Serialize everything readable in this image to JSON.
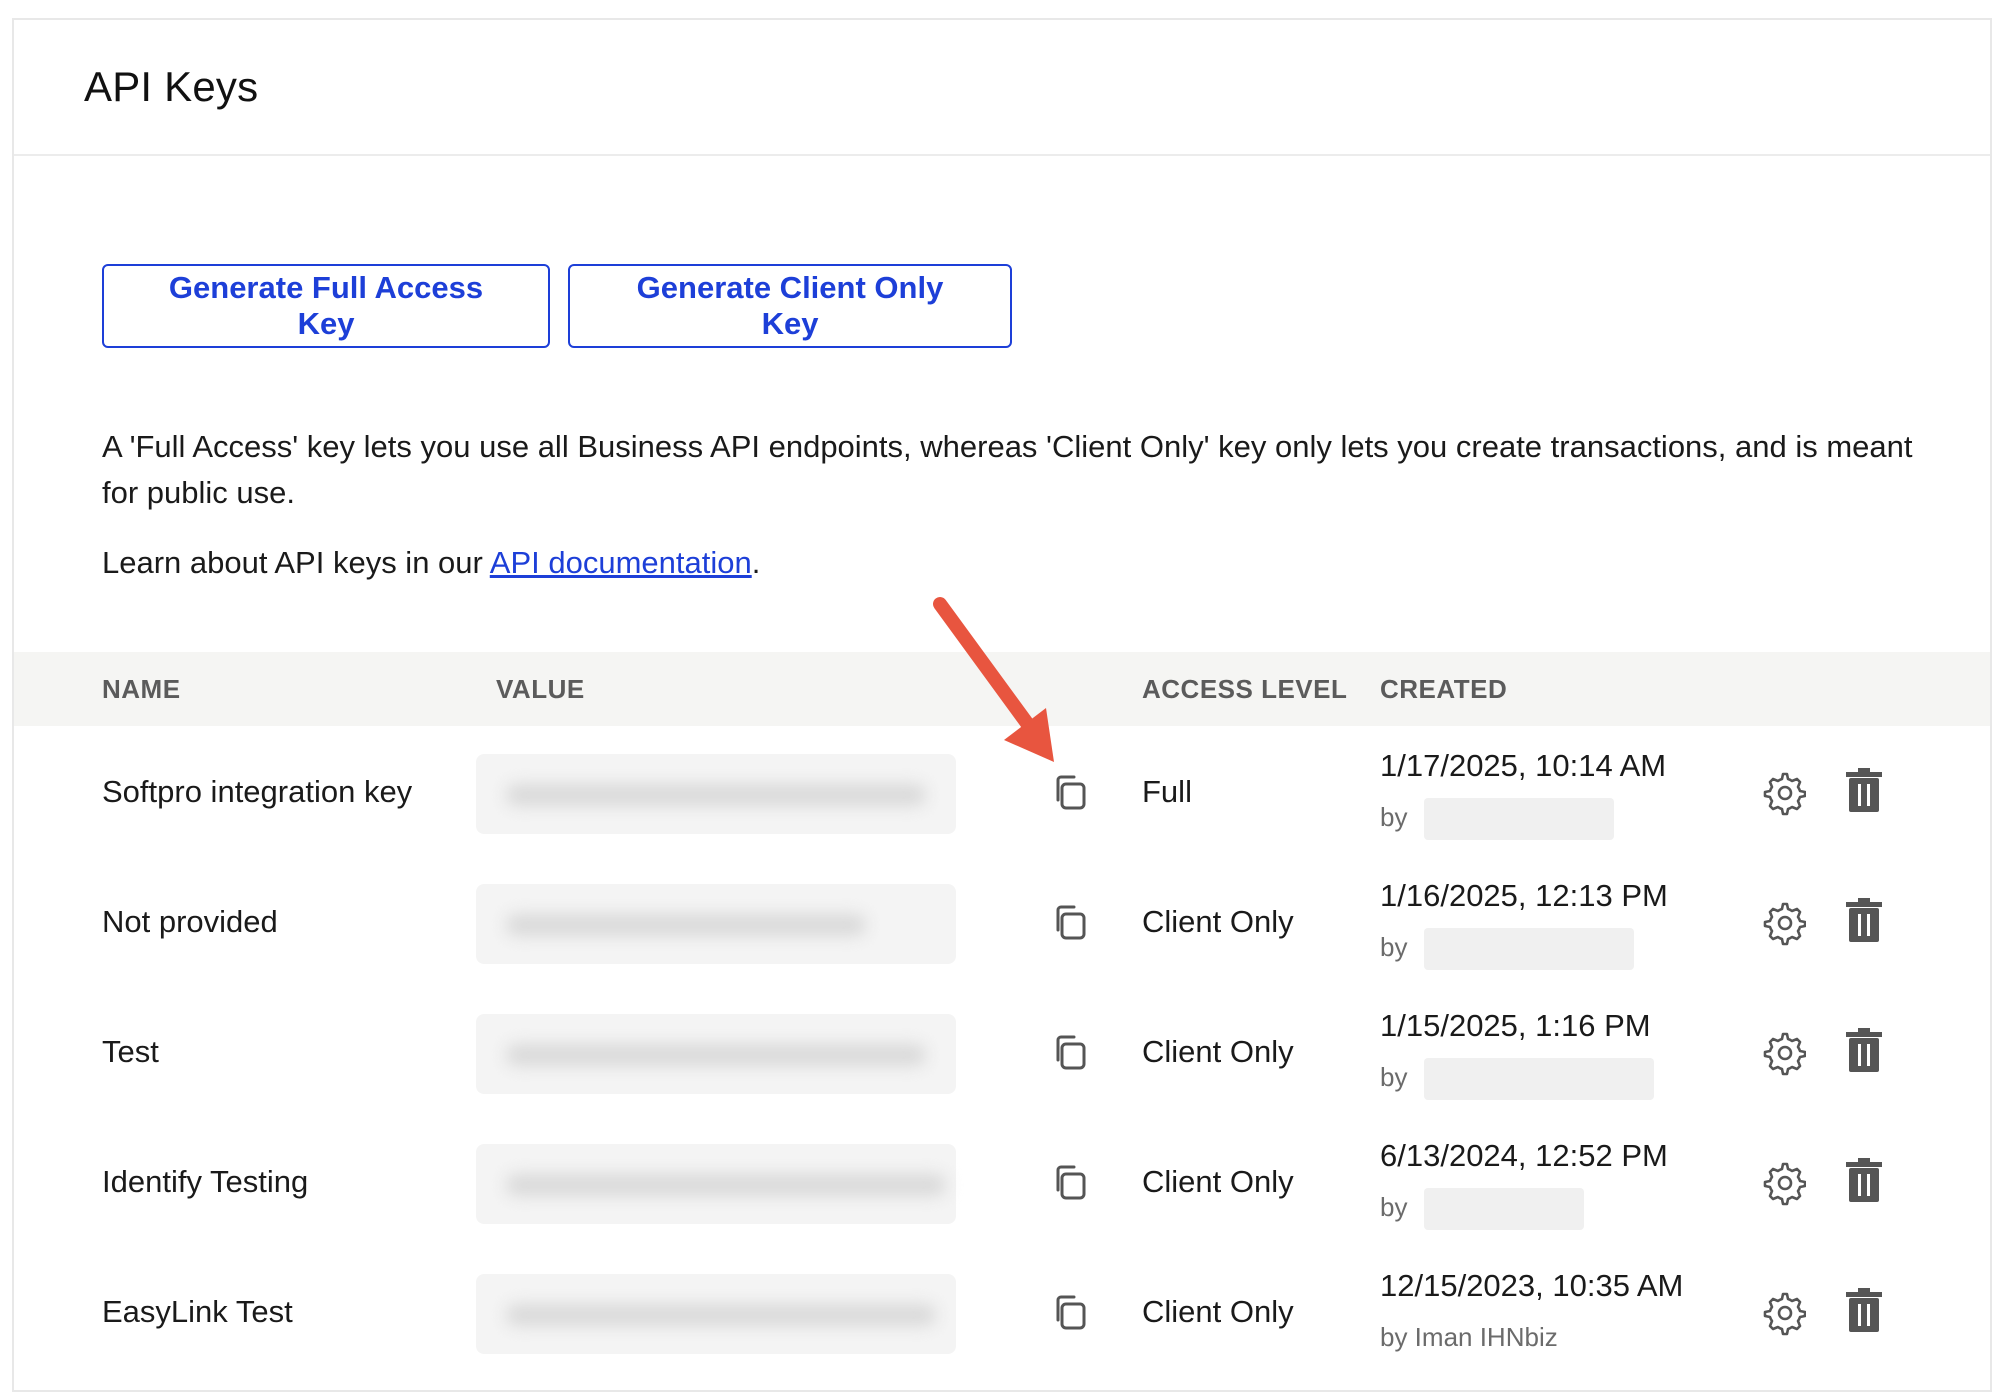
{
  "header": {
    "title": "API Keys"
  },
  "actions": {
    "full_access_label": "Generate Full Access Key",
    "client_only_label": "Generate Client Only Key"
  },
  "description": "A 'Full Access' key lets you use all Business API endpoints, whereas 'Client Only' key only lets you create transactions, and is meant for public use.",
  "learn": {
    "prefix": "Learn about API keys in our ",
    "link_text": "API documentation",
    "suffix": "."
  },
  "table": {
    "columns": {
      "name": "NAME",
      "value": "VALUE",
      "access_level": "ACCESS LEVEL",
      "created": "CREATED"
    },
    "rows": [
      {
        "name": "Softpro integration key",
        "access_level": "Full",
        "created_date": "1/17/2025, 10:14 AM",
        "created_by": "by"
      },
      {
        "name": "Not provided",
        "access_level": "Client Only",
        "created_date": "1/16/2025, 12:13 PM",
        "created_by": "by"
      },
      {
        "name": "Test",
        "access_level": "Client Only",
        "created_date": "1/15/2025, 1:16 PM",
        "created_by": "by"
      },
      {
        "name": "Identify Testing",
        "access_level": "Client Only",
        "created_date": "6/13/2024, 12:52 PM",
        "created_by": "by"
      },
      {
        "name": "EasyLink Test",
        "access_level": "Client Only",
        "created_date": "12/15/2023, 10:35 AM",
        "created_by": "by Iman IHNbiz"
      }
    ]
  },
  "icons": {
    "copy": "copy-icon",
    "settings": "gear-icon",
    "delete": "trash-icon",
    "annotation": "arrow-icon"
  },
  "colors": {
    "accent": "#1d3fd8",
    "header_bg": "#f5f5f3",
    "annotation_arrow": "#e8553f",
    "icon": "#555555"
  }
}
